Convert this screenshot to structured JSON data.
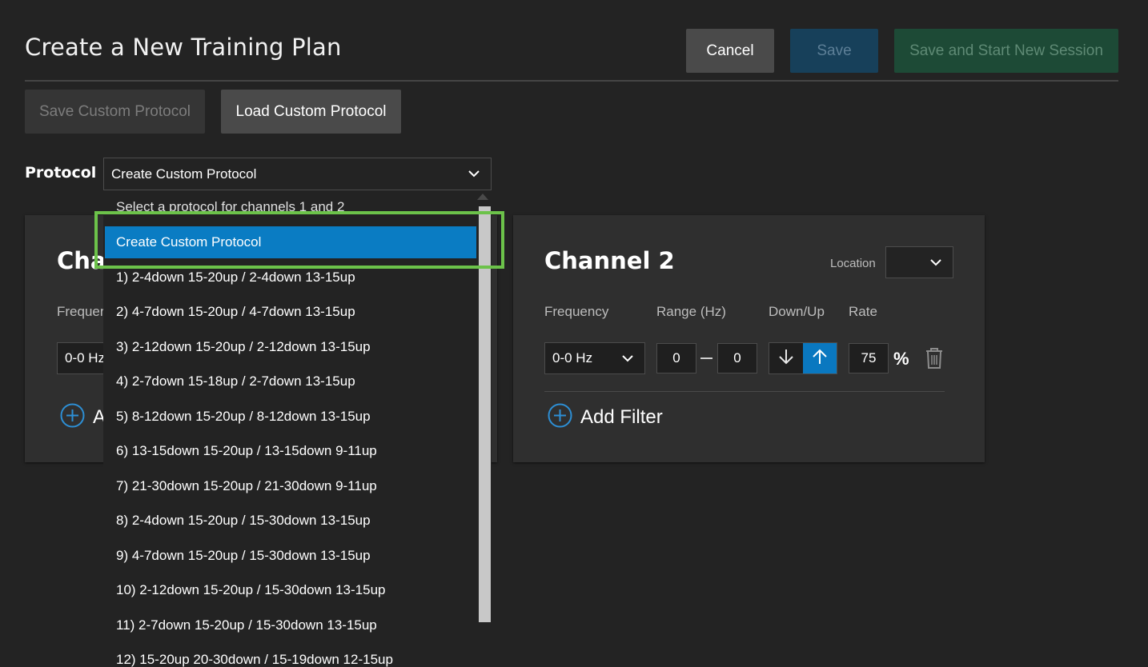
{
  "header": {
    "title": "Create a New Training Plan",
    "cancel_label": "Cancel",
    "save_label": "Save",
    "save_start_label": "Save and Start New Session"
  },
  "toolbar": {
    "save_custom_label": "Save Custom Protocol",
    "load_custom_label": "Load Custom Protocol"
  },
  "protocol": {
    "label": "Protocol",
    "selected": "Create Custom Protocol",
    "options": [
      "Select a protocol for channels 1 and 2",
      "Create Custom Protocol",
      "1) 2-4down 15-20up / 2-4down 13-15up",
      "2) 4-7down 15-20up / 4-7down 13-15up",
      "3) 2-12down 15-20up / 2-12down 13-15up",
      "4) 2-7down 15-18up / 2-7down 13-15up",
      "5) 8-12down 15-20up / 8-12down 13-15up",
      "6) 13-15down 15-20up / 13-15down 9-11up",
      "7) 21-30down 15-20up / 21-30down 9-11up",
      "8) 2-4down 15-20up / 15-30down 13-15up",
      "9) 4-7down 15-20up / 15-30down 13-15up",
      "10) 2-12down 15-20up / 15-30down 13-15up",
      "11) 2-7down 15-20up / 15-30down  13-15up",
      "12) 15-20up 20-30down / 15-19down 12-15up"
    ]
  },
  "channel1": {
    "title_visible": "Cha",
    "frequency_label_visible": "Frequer",
    "frequency_value_visible": "0-0 Hz",
    "add_filter_visible": "A"
  },
  "channel2": {
    "title": "Channel 2",
    "location_label": "Location",
    "location_value": "",
    "frequency_label": "Frequency",
    "range_label": "Range (Hz)",
    "downup_label": "Down/Up",
    "rate_label": "Rate",
    "frequency_value": "0-0 Hz",
    "range_min": "0",
    "range_max": "0",
    "rate_value": "75",
    "rate_unit": "%",
    "direction": "up",
    "add_filter_label": "Add Filter"
  },
  "colors": {
    "background": "#232323",
    "card": "#2f2f2f",
    "accent_blue": "#0a7cc3",
    "highlight_green": "#6cc24a"
  }
}
